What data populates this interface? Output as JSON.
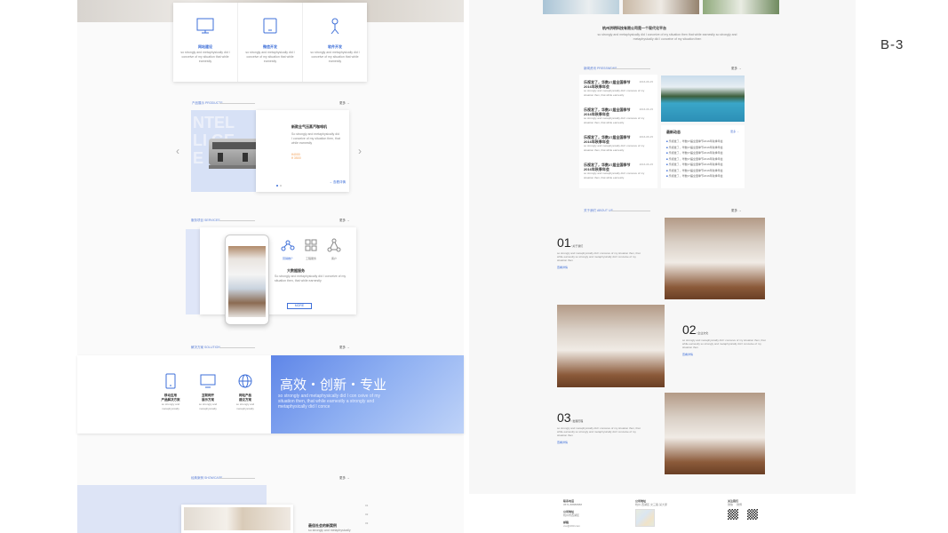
{
  "label": "B-3",
  "left": {
    "features": [
      {
        "icon": "monitor-icon",
        "title": "网站建设",
        "desc": "so strongly and metaphysically did I conceive of my situation that while earnestly"
      },
      {
        "icon": "tablet-icon",
        "title": "微信开发",
        "desc": "so strongly and metaphysically did I conceive of my situation that while earnestly"
      },
      {
        "icon": "person-icon",
        "title": "软件开发",
        "desc": "so strongly and metaphysically did I conceive of my situation that while earnestly"
      }
    ],
    "product": {
      "section_label": "产品展示 PRODUCTS",
      "more": "更多 →",
      "bg_text": "NTEL LI GE E",
      "title": "新款全气压蒸汽咖啡机",
      "desc": "So strongly and metaphysically did I conceive of my situation then, that while earnestly",
      "price_label": "¥4000",
      "price": "¥ 3500",
      "view_more": "→ 查看详情"
    },
    "services": {
      "section_label": "服务项目 SERVICES",
      "more": "更多 →",
      "items": [
        {
          "icon": "network-icon",
          "label": "营销推广"
        },
        {
          "icon": "grid-icon",
          "label": "工程服务"
        },
        {
          "icon": "share-icon",
          "label": "客户"
        }
      ],
      "title": "大数据服务",
      "desc": "So strongly and metaphysically did I conceive of my situation then, that while earnestly",
      "button": "MORE"
    },
    "solutions": {
      "section_label": "解决方案 SOLUTION",
      "more": "更多 →",
      "items": [
        {
          "icon": "tablet-icon",
          "title": "移动应用\n产品解决方案",
          "desc": "so strongly and metaphysically"
        },
        {
          "icon": "monitor-icon",
          "title": "互联网开\n展示方案",
          "desc": "so strongly and metaphysically"
        },
        {
          "icon": "globe-icon",
          "title": "网站产品\n建议方案",
          "desc": "so strongly and metaphysically"
        }
      ],
      "banner_title": "高效・创新・专业",
      "banner_sub": "so strongly and metaphysically did I con ceive of my situation then, that while earnestly a strongly and metaphysically did I conce"
    },
    "cases": {
      "section_label": "经典案例 SHOWCASE",
      "more": "更多 →",
      "title": "最佳社会的新案例",
      "desc": "so strongly and metaphysically"
    }
  },
  "right": {
    "intro_title": "杭州洪明科技有限公司是一个现代化平台",
    "intro_text": "so strongly and metaphysically did I conceive of my situation then that while earnestly so strongly and metaphysically did I conceive of my situation then",
    "news": {
      "section_label": "新闻资讯 PRESSNEWS",
      "more": "更多 →",
      "items": [
        {
          "title": "乐视发了，华数27届全国季节2016年秋季年会",
          "date": "2016-06-15",
          "desc": "so strongly and metaphysically did I conceive of my situation then, that while earnestly"
        },
        {
          "title": "乐视发了，华数27届全国季节2016年秋季年会",
          "date": "2016-06-15",
          "desc": "so strongly and metaphysically did I conceive of my situation then, that while earnestly"
        },
        {
          "title": "乐视发了，华数27届全国季节2016年秋季年会",
          "date": "2016-06-15",
          "desc": "so strongly and metaphysically did I conceive of my situation then, that while earnestly"
        },
        {
          "title": "乐视发了，华数27届全国季节2016年秋季年会",
          "date": "2016-06-15",
          "desc": "so strongly and metaphysically did I conceive of my situation then, that while earnestly"
        }
      ],
      "side_title": "最新动态",
      "side_more": "更多 →",
      "side_items": [
        "乐视发了，华数27届全国季节2016年秋季年会",
        "乐视发了，华数27届全国季节2016年秋季年会",
        "乐视发了，华数27届全国季节2016年秋季年会",
        "乐视发了，华数27届全国季节2016年秋季年会",
        "乐视发了，华数27届全国季节2016年秋季年会",
        "乐视发了，华数27届全国季节2016年秋季年会",
        "乐视发了，华数27届全国季节2016年秋季年会"
      ]
    },
    "about": {
      "section_label": "关于我们 ABOUT US",
      "more": "更多 →",
      "items": [
        {
          "num": "01",
          "sub": "/ 关于我们",
          "text": "so strongly and metaphysically did I conceive of my situation then, that while earnestly so strongly and metaphysically did I conceive of my situation then",
          "link": "查看详情"
        },
        {
          "num": "02",
          "sub": "/ 企业文化",
          "text": "so strongly and metaphysically did I conceive of my situation then, that while earnestly so strongly and metaphysically did I conceive of my situation then",
          "link": "查看详情"
        },
        {
          "num": "03",
          "sub": "/ 发展历程",
          "text": "so strongly and metaphysically did I conceive of my situation then, that while earnestly so strongly and metaphysically did I conceive of my situation then",
          "link": "查看详情"
        }
      ]
    },
    "footer": {
      "col1_title": "联系电话",
      "col1_text": "0571-88888888",
      "col1_title2": "公司地址",
      "col1_text2": "杭州市西湖区",
      "col1_title3": "邮箱",
      "col1_text3": "xxx@163.com",
      "col2_title": "公司地址",
      "col2_text": "杭州·西湖区·文三路·某大厦",
      "col3_title": "关注我们",
      "col3_items": [
        "微信",
        "微博"
      ]
    }
  }
}
